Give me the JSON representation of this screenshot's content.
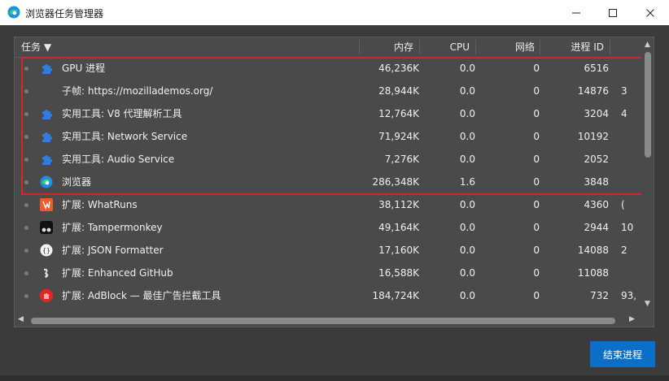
{
  "window": {
    "title": "浏览器任务管理器"
  },
  "header": {
    "task": "任务 ▼",
    "memory": "内存",
    "cpu": "CPU",
    "network": "网络",
    "pid": "进程 ID"
  },
  "rows": [
    {
      "icon": "puzzle-icon",
      "name": "GPU 进程",
      "memory": "46,236K",
      "cpu": "0.0",
      "network": "0",
      "pid": "6516",
      "extra": ""
    },
    {
      "icon": "",
      "name": "子帧: https://mozillademos.org/",
      "memory": "28,944K",
      "cpu": "0.0",
      "network": "0",
      "pid": "14876",
      "extra": "3"
    },
    {
      "icon": "puzzle-icon",
      "name": "实用工具: V8 代理解析工具",
      "memory": "12,764K",
      "cpu": "0.0",
      "network": "0",
      "pid": "3204",
      "extra": "4"
    },
    {
      "icon": "puzzle-icon",
      "name": "实用工具: Network Service",
      "memory": "71,924K",
      "cpu": "0.0",
      "network": "0",
      "pid": "10192",
      "extra": ""
    },
    {
      "icon": "puzzle-icon",
      "name": "实用工具: Audio Service",
      "memory": "7,276K",
      "cpu": "0.0",
      "network": "0",
      "pid": "2052",
      "extra": ""
    },
    {
      "icon": "edge-browser-icon",
      "name": "浏览器",
      "memory": "286,348K",
      "cpu": "1.6",
      "network": "0",
      "pid": "3848",
      "extra": ""
    },
    {
      "icon": "whatruns-icon",
      "name": "扩展: WhatRuns",
      "memory": "38,112K",
      "cpu": "0.0",
      "network": "0",
      "pid": "4360",
      "extra": "("
    },
    {
      "icon": "tampermonkey-icon",
      "name": "扩展: Tampermonkey",
      "memory": "49,164K",
      "cpu": "0.0",
      "network": "0",
      "pid": "2944",
      "extra": "10"
    },
    {
      "icon": "json-formatter-icon",
      "name": "扩展: JSON Formatter",
      "memory": "17,160K",
      "cpu": "0.0",
      "network": "0",
      "pid": "14088",
      "extra": "2"
    },
    {
      "icon": "enhanced-github-icon",
      "name": "扩展: Enhanced GitHub",
      "memory": "16,588K",
      "cpu": "0.0",
      "network": "0",
      "pid": "11088",
      "extra": ""
    },
    {
      "icon": "adblock-icon",
      "name": "扩展: AdBlock — 最佳广告拦截工具",
      "memory": "184,724K",
      "cpu": "0.0",
      "network": "0",
      "pid": "732",
      "extra": "93,"
    }
  ],
  "footer": {
    "end_process": "结束进程"
  },
  "colors": {
    "selection_border": "#d6252b",
    "button": "#0b6ec9"
  }
}
